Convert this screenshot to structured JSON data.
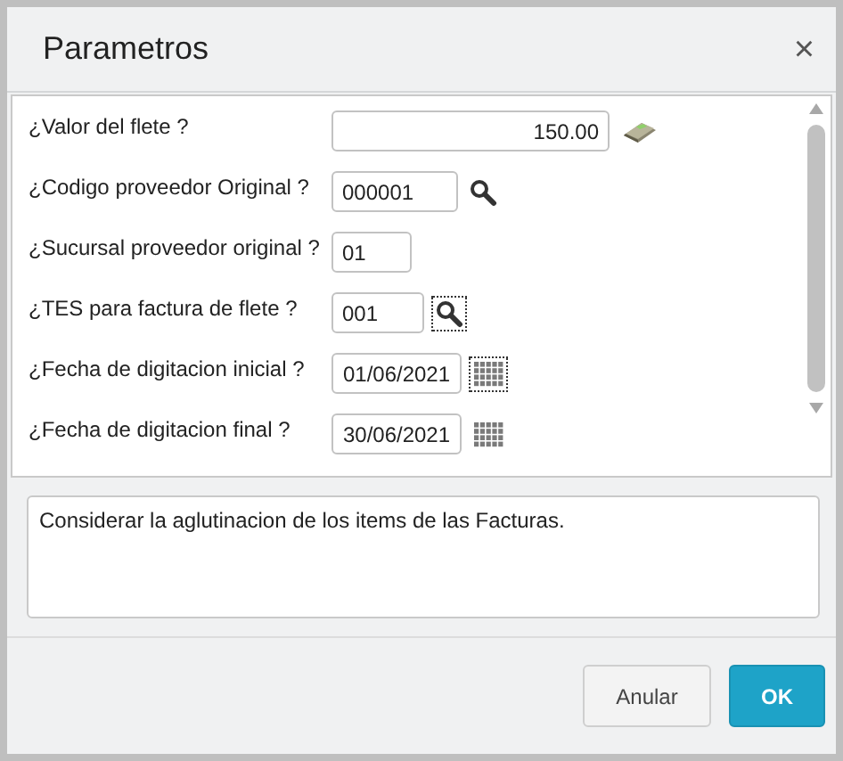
{
  "window": {
    "title": "Parametros",
    "close": "×"
  },
  "fields": [
    {
      "label": "¿Valor del flete ?",
      "value": "150.00",
      "kind": "amount",
      "button": {
        "kind": "calculator",
        "focused": false
      }
    },
    {
      "label": "¿Codigo proveedor Original ?",
      "value": "000001",
      "kind": "code",
      "button": {
        "kind": "search",
        "focused": false
      }
    },
    {
      "label": "¿Sucursal proveedor original ?",
      "value": "01",
      "kind": "code"
    },
    {
      "label": "¿TES para factura de flete ?",
      "value": "001",
      "kind": "code",
      "button": {
        "kind": "search",
        "focused": true
      }
    },
    {
      "label": "¿Fecha de digitacion inicial ?",
      "value": "01/06/2021",
      "kind": "date",
      "button": {
        "kind": "calendar",
        "focused": true
      }
    },
    {
      "label": "¿Fecha de digitacion final ?",
      "value": "30/06/2021",
      "kind": "date",
      "button": {
        "kind": "calendar",
        "focused": false
      }
    }
  ],
  "description": "Considerar la aglutinacion de los items de las Facturas.",
  "buttons": [
    {
      "label": "Anular",
      "kind": "secondary"
    },
    {
      "label": "OK",
      "kind": "primary"
    }
  ]
}
